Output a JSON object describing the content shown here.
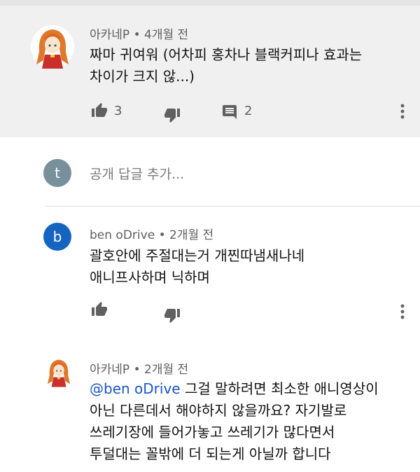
{
  "comments": [
    {
      "author": "아카네P",
      "time": "4개월 전",
      "text_line1": "짜마 귀여워 (어차피 홍차나 블랙커피나 효과는",
      "text_line2": "차이가 크지 않...)",
      "likes": "3",
      "replies": "2"
    },
    {
      "author": "ben oDrive",
      "avatar_letter": "b",
      "avatar_color": "#1565c0",
      "time": "2개월 전",
      "text_line1": "괄호안에 주절대는거 개찐따냄새나네",
      "text_line2": "애니프사하며 닉하며"
    },
    {
      "author": "아카네P",
      "time": "2개월 전",
      "mention": "@ben oDrive",
      "text_line1_rest": " 그걸 말하려면 최소한 애니영상이",
      "text_line2": "아닌 다른데서 해야하지 않을까요? 자기발로",
      "text_line3": "쓰레기장에 들어가놓고 쓰레기가 많다면서",
      "text_line4": "투덜대는 꼴밖에 더 되는게 아닐까 합니다"
    }
  ],
  "reply_box": {
    "avatar_letter": "t",
    "avatar_color": "#78909c",
    "placeholder": "공개 답글 추가..."
  },
  "icons": [
    "thumb-up-icon",
    "thumb-down-icon",
    "reply-comment-icon",
    "more-vert-icon"
  ]
}
